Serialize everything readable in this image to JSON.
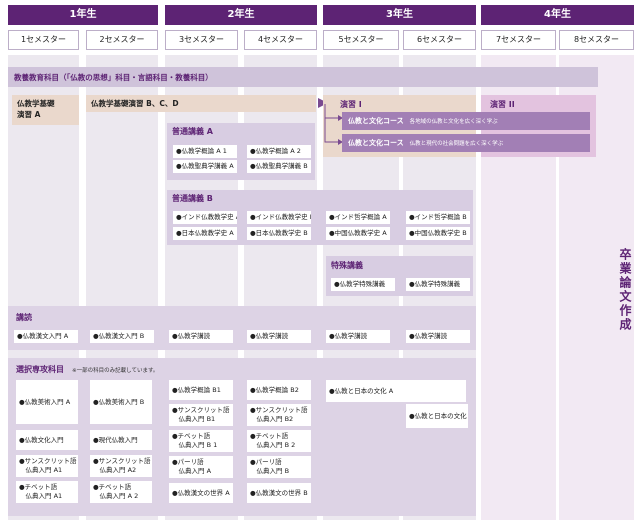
{
  "years": [
    "1年生",
    "2年生",
    "3年生",
    "4年生"
  ],
  "semesters": [
    "1セメスター",
    "2セメスター",
    "3セメスター",
    "4セメスター",
    "5セメスター",
    "6セメスター",
    "7セメスター",
    "8セメスター"
  ],
  "general_row": "教養教育科目（「仏教の思想」科目・言語科目・教養科目）",
  "basic": {
    "b1": "仏教学基礎\n演習 A",
    "b2": "仏教学基礎演習 B、C、D"
  },
  "seminar": {
    "s1": "演習 I",
    "s2": "演習 II"
  },
  "course_a": {
    "name": "仏教と文化コース",
    "desc": "各地域の仏教と文化を広く深く学ぶ"
  },
  "course_b": {
    "name": "仏教と文化コース",
    "desc": "仏教と現代の社会問題を広く深く学ぶ"
  },
  "general_a": {
    "title": "普通講義 A",
    "items": [
      "●仏教学概論 A 1",
      "●仏教学概論 A 2",
      "●仏教聖典学講義 A",
      "●仏教聖典学講義 B"
    ]
  },
  "general_b": {
    "title": "普通講義 B",
    "items": [
      "●インド仏教教学史 A",
      "●インド仏教教学史 B",
      "●インド哲学概論 A",
      "●インド哲学概論 B",
      "●日本仏教教学史 A",
      "●日本仏教教学史 B",
      "●中国仏教教学史 A",
      "●中国仏教教学史 B"
    ]
  },
  "special": {
    "title": "特殊講義",
    "items": [
      "●仏教学特殊講義",
      "●仏教学特殊講義"
    ]
  },
  "reading": {
    "title": "講読",
    "items": [
      "●仏教漢文入門 A",
      "●仏教漢文入門 B",
      "●仏教学講読",
      "●仏教学講読",
      "●仏教学講読",
      "●仏教学講読"
    ]
  },
  "elective": {
    "title": "選択専攻科目",
    "note": "※一部の科目のみ記載しています。",
    "col1": [
      "●仏教美術入門 A",
      "●仏教文化入門",
      "●サンスクリット語\n　仏典入門 A1",
      "●チベット語\n　仏典入門 A1"
    ],
    "col2": [
      "●仏教美術入門 B",
      "●現代仏教入門",
      "●サンスクリット語\n　仏典入門 A2",
      "●チベット語\n　仏典入門 A 2"
    ],
    "col3": [
      "●仏教学概論 B1",
      "●サンスクリット語\n　仏典入門 B1",
      "●チベット語\n　仏典入門 B 1",
      "●パーリ語\n　仏典入門 A",
      "●仏教漢文の世界 A"
    ],
    "col4": [
      "●仏教学概論 B2",
      "●サンスクリット語\n　仏典入門 B2",
      "●チベット語\n　仏典入門 B 2",
      "●パーリ語\n　仏典入門 B",
      "●仏教漢文の世界 B"
    ],
    "col5": "●仏教と日本の文化 A",
    "col6": "●仏教と日本の文化 B"
  },
  "thesis": "卒業論文作成",
  "colors": {
    "header": "#5d2374",
    "band": "#cfc3da",
    "course": "#a27fb5",
    "tan": "#ead8cc"
  }
}
